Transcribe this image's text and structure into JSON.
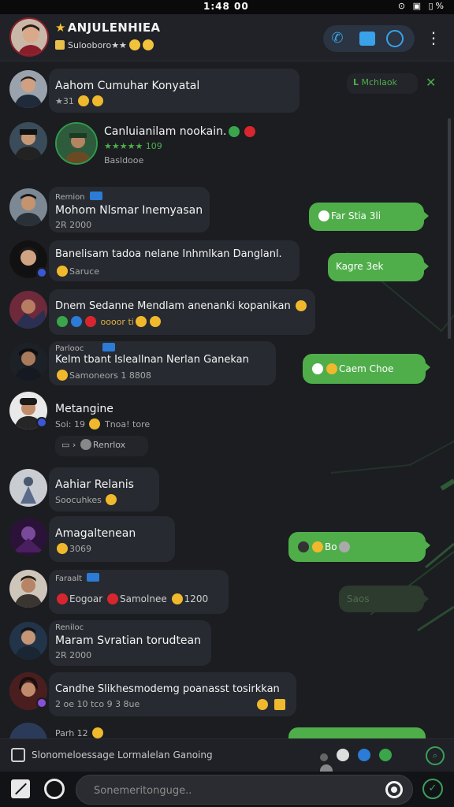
{
  "status": {
    "time": "1:48 00",
    "icons": "⊙ ▣ ▯%"
  },
  "header": {
    "title": "ANJULENHIEA",
    "subtitle": "Sulooboro★★",
    "colors": {
      "accent": "#3aa2e8",
      "sent": "#4fae4a"
    }
  },
  "messages": [
    {
      "name": "",
      "text": "Aahom Cumuhar Konyatal",
      "meta": "★31"
    },
    {
      "name": "",
      "text": "Canluianilam nookain.",
      "meta": "★★★★★ 109",
      "meta2": "Basldooe"
    },
    {
      "name": "Remion",
      "text": "Mohom Nlsmar Inemyasan",
      "meta": "2R 2000"
    },
    {
      "name": "",
      "text": "Banelisam tadoa nelane Inhmlkan Danglanl.",
      "meta": "Saruce"
    },
    {
      "name": "",
      "text": "Dnem Sedanne Mendlam anenanki kopanikan",
      "meta": "oooor ti"
    },
    {
      "name": "Parlooc",
      "text": "Kelm tbant Isleallnan Nerlan Ganekan",
      "meta": "Samoneors 1 8808"
    },
    {
      "name": "",
      "text": "Metangine",
      "meta": "Soi: 19",
      "meta_b": "Tnoa! tore",
      "pill": "Renrlox"
    },
    {
      "name": "",
      "text": "Aahiar Relanis",
      "meta": "Soocuhkes"
    },
    {
      "name": "",
      "text": "Amagaltenean",
      "meta": "3069"
    },
    {
      "name": "Faraalt",
      "text": "",
      "meta": "Eogoar",
      "meta_b": "Samolnee",
      "meta_c": "1200"
    },
    {
      "name": "Reniloc",
      "text": "Maram Svratian torudtean",
      "meta": "2R 2000"
    },
    {
      "name": "",
      "text": "Candhe Slikhesmodemg poanasst tosirkkan",
      "meta": "2 oe 10 tco 9 3 8ue"
    },
    {
      "name": "Parh 12",
      "text": "",
      "meta": ""
    }
  ],
  "sent": [
    {
      "label": "Mchlaok"
    },
    {
      "label": "Far Stia  3li"
    },
    {
      "label": "Kagre  3ek"
    },
    {
      "label": "Caem  Choe"
    },
    {
      "label": "Bo"
    },
    {
      "label": "Saos"
    }
  ],
  "compose": {
    "text": "Slonomeloessage Lormalelan Ganoing",
    "placeholder": "Sonemeritonguge.."
  }
}
